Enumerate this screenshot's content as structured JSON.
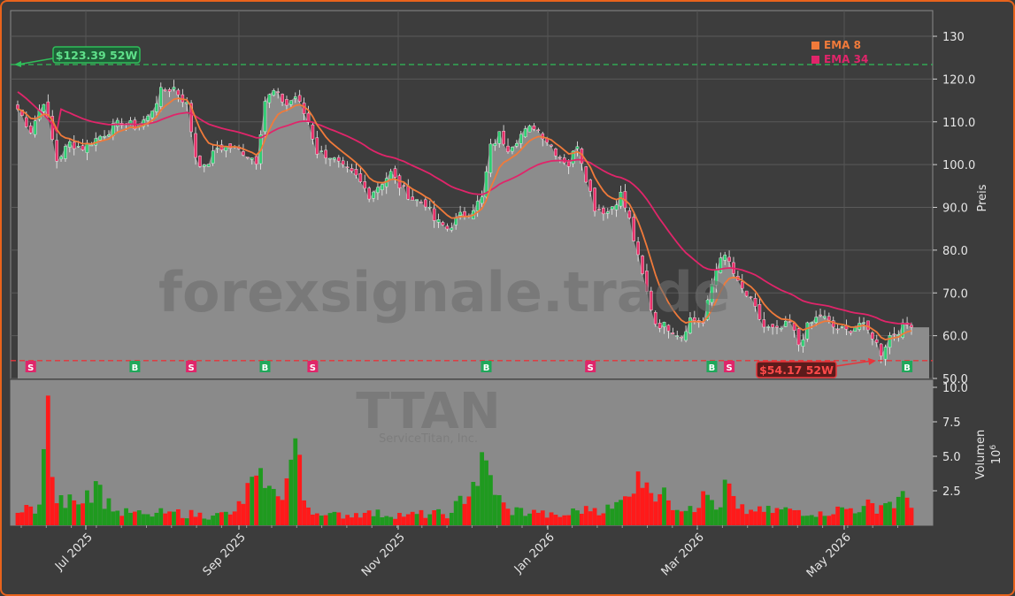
{
  "chart_data": {
    "type": "candlestick",
    "ticker_watermark": "TTAN",
    "company_watermark": "ServiceTitan, Inc.",
    "site_watermark": "forexsignale.trade",
    "price_axis": {
      "label": "Preis",
      "ylim": [
        50,
        136
      ],
      "ticks": [
        "50.0",
        "60.0",
        "70.0",
        "80.0",
        "90.0",
        "100.0",
        "110.0",
        "120.0",
        "130"
      ]
    },
    "volume_axis": {
      "label": "Volumen",
      "unit": "10^6",
      "ylim": [
        0,
        10
      ],
      "ticks": [
        "2.5",
        "5.0",
        "7.5",
        "10.0"
      ]
    },
    "x_axis": {
      "ticks": [
        "Jul 2025",
        "Sep 2025",
        "Nov 2025",
        "Jan 2026",
        "Mar 2026",
        "May 2026"
      ]
    },
    "legend": [
      {
        "name": "EMA 8",
        "color": "#f07a3a"
      },
      {
        "name": "EMA 34",
        "color": "#e0256a"
      }
    ],
    "high_52w": {
      "label": "$123.39 52W",
      "value": 123.39,
      "color": "#2fbf5a"
    },
    "low_52w": {
      "label": "$54.17 52W",
      "value": 54.17,
      "color": "#e8343a"
    },
    "signals": [
      {
        "type": "S",
        "day": 3
      },
      {
        "type": "B",
        "day": 27
      },
      {
        "type": "S",
        "day": 40
      },
      {
        "type": "B",
        "day": 57
      },
      {
        "type": "S",
        "day": 68
      },
      {
        "type": "B",
        "day": 108
      },
      {
        "type": "S",
        "day": 132
      },
      {
        "type": "B",
        "day": 160
      },
      {
        "type": "S",
        "day": 164
      },
      {
        "type": "B",
        "day": 205
      }
    ],
    "close_anchors": [
      [
        0,
        113
      ],
      [
        3,
        108
      ],
      [
        6,
        115
      ],
      [
        9,
        101
      ],
      [
        12,
        105
      ],
      [
        15,
        104
      ],
      [
        18,
        106
      ],
      [
        21,
        108
      ],
      [
        24,
        110
      ],
      [
        27,
        109
      ],
      [
        30,
        111
      ],
      [
        33,
        117
      ],
      [
        36,
        118
      ],
      [
        39,
        114
      ],
      [
        41,
        102
      ],
      [
        43,
        99
      ],
      [
        46,
        104
      ],
      [
        49,
        104
      ],
      [
        52,
        103
      ],
      [
        55,
        101
      ],
      [
        57,
        115
      ],
      [
        59,
        117
      ],
      [
        62,
        114
      ],
      [
        64,
        116
      ],
      [
        67,
        110
      ],
      [
        69,
        103
      ],
      [
        72,
        102
      ],
      [
        75,
        99
      ],
      [
        78,
        97
      ],
      [
        81,
        93
      ],
      [
        84,
        96
      ],
      [
        86,
        98
      ],
      [
        88,
        95
      ],
      [
        91,
        92
      ],
      [
        94,
        91
      ],
      [
        96,
        87
      ],
      [
        99,
        85
      ],
      [
        102,
        88
      ],
      [
        104,
        89
      ],
      [
        107,
        92
      ],
      [
        109,
        104
      ],
      [
        111,
        107
      ],
      [
        113,
        104
      ],
      [
        116,
        107
      ],
      [
        119,
        109
      ],
      [
        121,
        107
      ],
      [
        124,
        103
      ],
      [
        127,
        100
      ],
      [
        129,
        105
      ],
      [
        131,
        97
      ],
      [
        133,
        90
      ],
      [
        136,
        89
      ],
      [
        139,
        93
      ],
      [
        141,
        87
      ],
      [
        143,
        78
      ],
      [
        145,
        70
      ],
      [
        147,
        63
      ],
      [
        150,
        62
      ],
      [
        153,
        60
      ],
      [
        155,
        64
      ],
      [
        158,
        63
      ],
      [
        160,
        72
      ],
      [
        162,
        79
      ],
      [
        164,
        77
      ],
      [
        166,
        72
      ],
      [
        169,
        68
      ],
      [
        172,
        62
      ],
      [
        175,
        61
      ],
      [
        178,
        63
      ],
      [
        180,
        58
      ],
      [
        182,
        62
      ],
      [
        185,
        65
      ],
      [
        188,
        62
      ],
      [
        191,
        61
      ],
      [
        194,
        63
      ],
      [
        197,
        60
      ],
      [
        199,
        56
      ],
      [
        201,
        60
      ],
      [
        204,
        62
      ],
      [
        206,
        63
      ]
    ],
    "volume_anchors": [
      [
        0,
        0.9
      ],
      [
        5,
        1.5
      ],
      [
        7,
        9.4
      ],
      [
        8,
        3.5
      ],
      [
        9,
        1.6
      ],
      [
        13,
        1.8
      ],
      [
        18,
        3.2
      ],
      [
        22,
        1.0
      ],
      [
        26,
        0.9
      ],
      [
        30,
        0.8
      ],
      [
        35,
        1.0
      ],
      [
        45,
        0.7
      ],
      [
        50,
        1.0
      ],
      [
        55,
        3.6
      ],
      [
        57,
        2.7
      ],
      [
        60,
        2.1
      ],
      [
        62,
        3.4
      ],
      [
        64,
        6.3
      ],
      [
        66,
        1.8
      ],
      [
        70,
        0.7
      ],
      [
        80,
        0.9
      ],
      [
        90,
        0.8
      ],
      [
        100,
        0.9
      ],
      [
        108,
        4.7
      ],
      [
        110,
        2.2
      ],
      [
        113,
        1.2
      ],
      [
        120,
        0.9
      ],
      [
        125,
        0.6
      ],
      [
        131,
        1.4
      ],
      [
        137,
        1.2
      ],
      [
        140,
        2.1
      ],
      [
        143,
        3.9
      ],
      [
        145,
        3.1
      ],
      [
        150,
        1.8
      ],
      [
        155,
        1.4
      ],
      [
        159,
        2.2
      ],
      [
        162,
        1.3
      ],
      [
        163,
        3.3
      ],
      [
        166,
        1.2
      ],
      [
        170,
        1.0
      ],
      [
        178,
        1.2
      ],
      [
        185,
        1.0
      ],
      [
        195,
        1.4
      ],
      [
        200,
        1.6
      ],
      [
        205,
        2.0
      ]
    ]
  }
}
